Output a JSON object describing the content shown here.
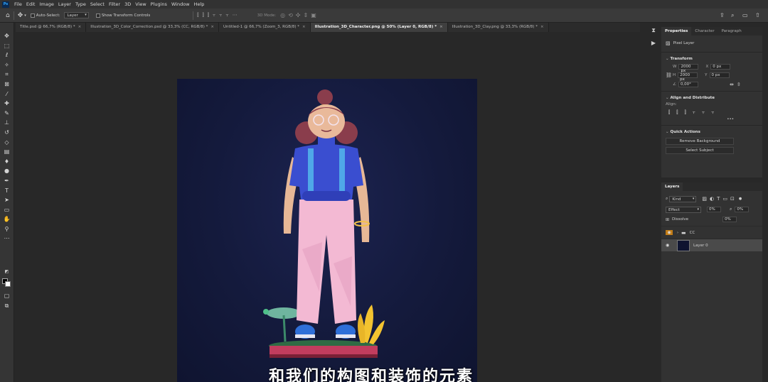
{
  "menubar": {
    "logo": "Ps",
    "items": [
      "File",
      "Edit",
      "Image",
      "Layer",
      "Type",
      "Select",
      "Filter",
      "3D",
      "View",
      "Plugins",
      "Window",
      "Help"
    ]
  },
  "options_bar": {
    "auto_select_label": "Auto-Select:",
    "auto_select_value": "Layer",
    "transform_controls_label": "Show Transform Controls",
    "mode_3d_label": "3D Mode:"
  },
  "tabs": [
    {
      "label": "Title.psd @ 66,7% (RGB/8) *",
      "active": false
    },
    {
      "label": "Illustration_3D_Color_Correction.psd @ 33,3% (CC, RGB/8) *",
      "active": false
    },
    {
      "label": "Untitled-1 @ 66,7% (Zoom_3, RGB/8) *",
      "active": false
    },
    {
      "label": "Illustration_3D_Character.png @ 50% (Layer 0, RGB/8) *",
      "active": true
    },
    {
      "label": "Illustration_3D_Clay.png @ 33,3% (RGB/8) *",
      "active": false
    }
  ],
  "tools": [
    "move-icon",
    "marquee-icon",
    "lasso-icon",
    "magic-wand-icon",
    "crop-icon",
    "frame-icon",
    "eyedropper-icon",
    "healing-icon",
    "brush-icon",
    "stamp-icon",
    "history-brush-icon",
    "eraser-icon",
    "gradient-icon",
    "blur-icon",
    "dodge-icon",
    "pen-icon",
    "type-icon",
    "path-select-icon",
    "shape-icon",
    "hand-icon",
    "zoom-icon",
    "more-icon"
  ],
  "properties": {
    "tabs": [
      "Properties",
      "Character",
      "Paragraph"
    ],
    "layer_type": "Pixel Layer",
    "transform_title": "Transform",
    "w_label": "W",
    "w_value": "2000 px",
    "h_label": "H",
    "h_value": "2000 px",
    "x_label": "X",
    "x_value": "0 px",
    "y_label": "Y",
    "y_value": "0 px",
    "angle_value": "0,00°",
    "align_title": "Align and Distribute",
    "align_label": "Align:",
    "quick_actions_title": "Quick Actions",
    "remove_bg_button": "Remove Background",
    "select_subject_button": "Select Subject",
    "ellipsis": "•••"
  },
  "layers_panel": {
    "title": "Layers",
    "filter_kind": "Kind",
    "blend_mode": "Effect",
    "opacity": "0%",
    "fill": "0%",
    "lock_label": "Dissolve",
    "fill_value": "0%",
    "layers": [
      {
        "name": "CC",
        "type": "group",
        "visible": true
      },
      {
        "name": "Layer 0",
        "type": "pixel",
        "visible": true,
        "selected": true
      }
    ]
  },
  "subtitle": "和我们的构图和装饰的元素",
  "colors": {
    "canvas_bg": "#141a3c",
    "accent_eye": "#f0a020"
  }
}
